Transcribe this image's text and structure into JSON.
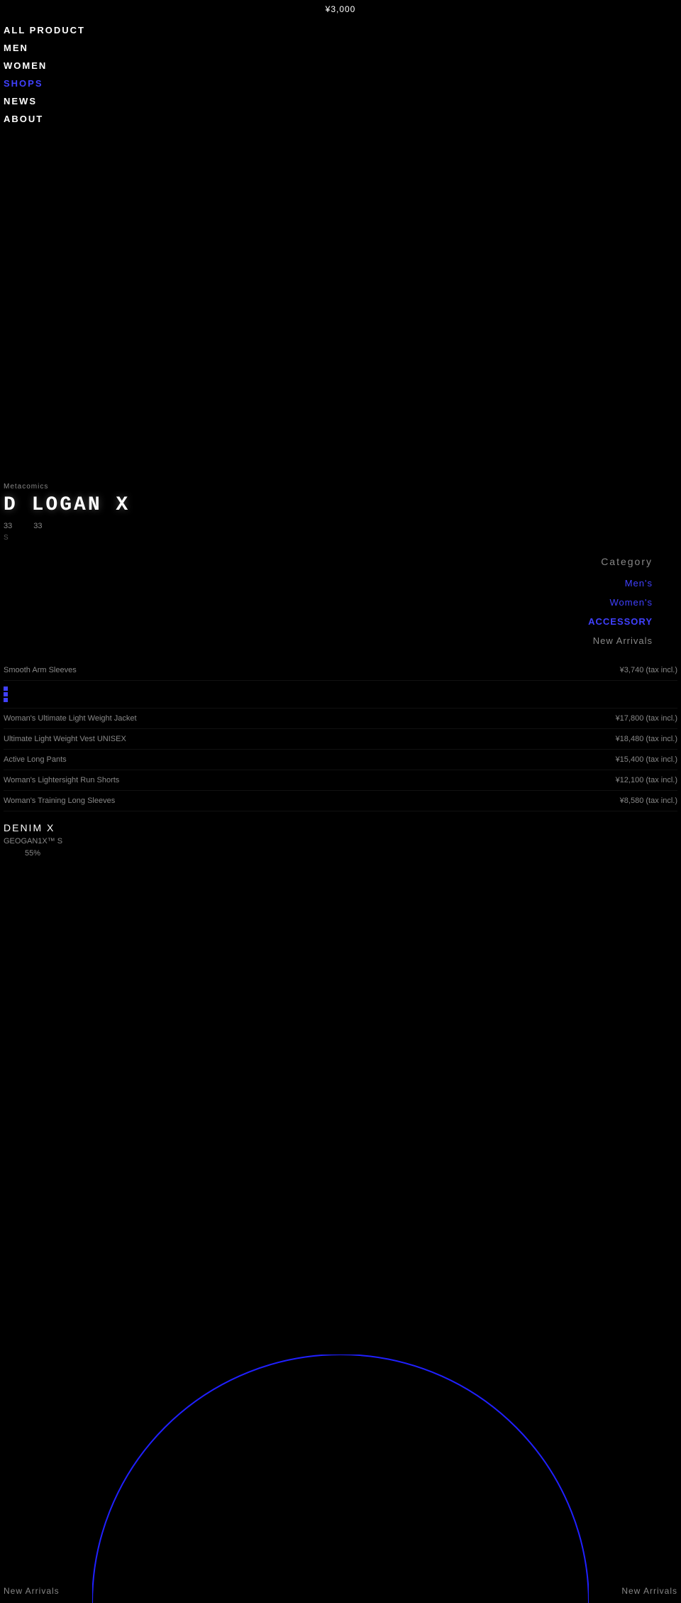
{
  "header": {
    "price": "¥3,000"
  },
  "nav": {
    "items": [
      {
        "label": "ALL PRODUCT",
        "active": false,
        "color": "white"
      },
      {
        "label": "MEN",
        "active": false,
        "color": "white"
      },
      {
        "label": "WOMEN",
        "active": false,
        "color": "white"
      },
      {
        "label": "SHOPS",
        "active": true,
        "color": "blue"
      },
      {
        "label": "NEWS",
        "active": false,
        "color": "white"
      },
      {
        "label": "ABOUT",
        "active": false,
        "color": "white"
      }
    ]
  },
  "metacomics": {
    "label": "Metacomics",
    "logo": "D LOGAN X",
    "stats": [
      {
        "value": "33"
      },
      {
        "value": "33"
      }
    ],
    "desc": "S"
  },
  "category": {
    "title": "Category",
    "items": [
      {
        "label": "Men's",
        "color": "blue"
      },
      {
        "label": "Women's",
        "color": "blue"
      },
      {
        "label": "ACCESSORY",
        "color": "blue"
      },
      {
        "label": "New Arrivals",
        "color": "gray"
      }
    ]
  },
  "products": {
    "items": [
      {
        "name": "Smooth Arm Sleeves",
        "price": "¥3,740 (tax incl.)"
      },
      {
        "name": "Woman's Ultimate Light Weight Jacket",
        "price": "¥17,800 (tax incl.)"
      },
      {
        "name": "Ultimate Light Weight Vest UNISEX",
        "price": "¥18,480 (tax incl.)"
      },
      {
        "name": "Active Long Pants",
        "price": "¥15,400 (tax incl.)"
      },
      {
        "name": "Woman's Lightersight Run Shorts",
        "price": "¥12,100 (tax incl.)"
      },
      {
        "name": "Woman's Training Long Sleeves",
        "price": "¥8,580 (tax incl.)"
      }
    ]
  },
  "denim": {
    "title": "DENIM X",
    "subtitle": "GEOGAN1X™ S",
    "percent": "55%"
  },
  "bottom": {
    "new_arrivals_left": "New Arrivals",
    "new_arrivals_right": "New Arrivals"
  }
}
